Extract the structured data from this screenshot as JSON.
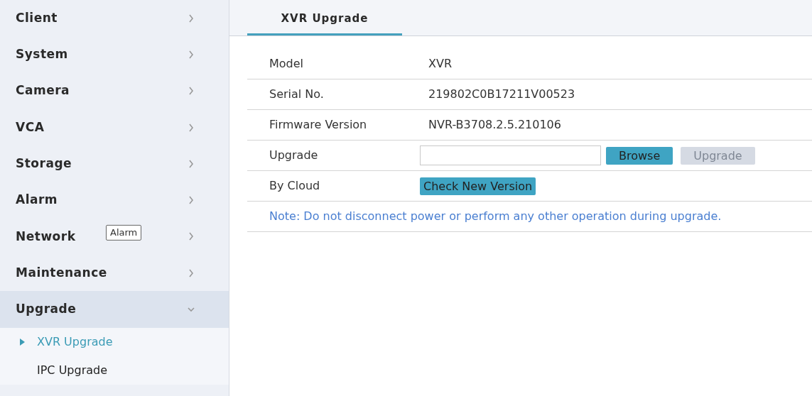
{
  "sidebar": {
    "items": [
      {
        "label": "Client",
        "expanded": false
      },
      {
        "label": "System",
        "expanded": false
      },
      {
        "label": "Camera",
        "expanded": false
      },
      {
        "label": "VCA",
        "expanded": false
      },
      {
        "label": "Storage",
        "expanded": false
      },
      {
        "label": "Alarm",
        "expanded": false
      },
      {
        "label": "Network",
        "expanded": false
      },
      {
        "label": "Maintenance",
        "expanded": false
      },
      {
        "label": "Upgrade",
        "expanded": true,
        "children": [
          {
            "label": "XVR Upgrade",
            "selected": true
          },
          {
            "label": "IPC Upgrade",
            "selected": false
          }
        ]
      }
    ]
  },
  "tooltip": {
    "text": "Alarm"
  },
  "tabs": [
    {
      "label": "XVR Upgrade",
      "selected": true
    }
  ],
  "rows": [
    {
      "kind": "text",
      "label": "Model",
      "value": "XVR"
    },
    {
      "kind": "text",
      "label": "Serial No.",
      "value": "219802C0B17211V00523"
    },
    {
      "kind": "text",
      "label": "Firmware Version",
      "value": "NVR-B3708.2.5.210106"
    },
    {
      "kind": "upload",
      "label": "Upgrade",
      "buttons": [
        {
          "label": "Browse",
          "disabled": false
        },
        {
          "label": "Upgrade",
          "disabled": true
        }
      ]
    },
    {
      "kind": "cloud",
      "label": "By Cloud",
      "buttons": [
        {
          "label": "Check New Version",
          "disabled": false
        }
      ]
    }
  ],
  "note": "Note: Do not disconnect power or perform any other operation during upgrade."
}
